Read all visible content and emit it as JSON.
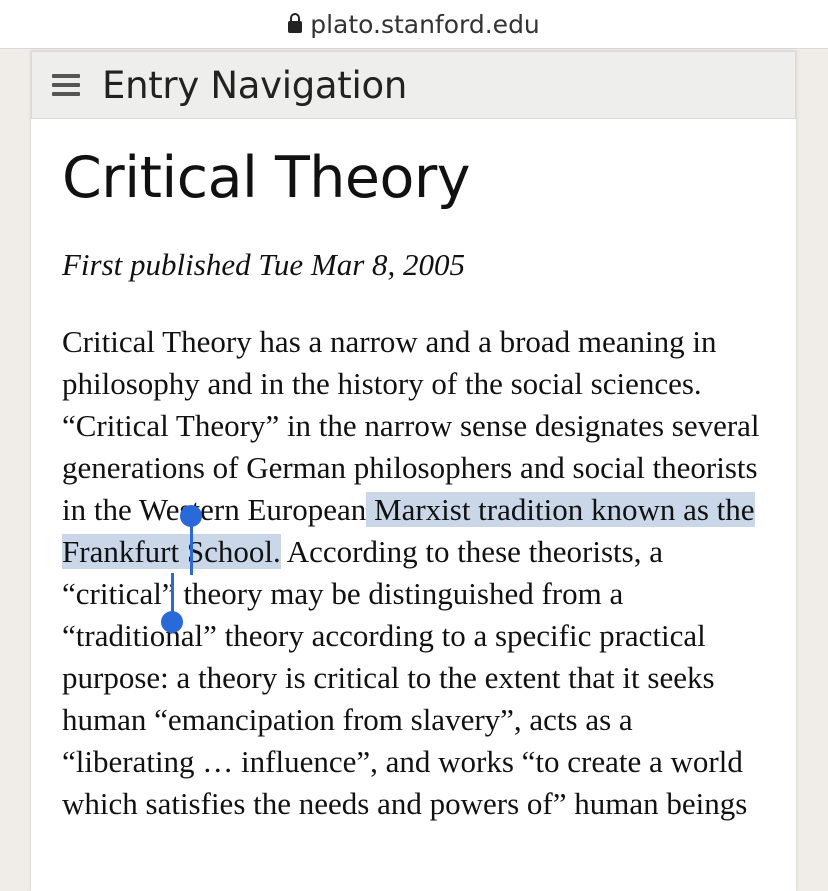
{
  "browser": {
    "url": "plato.stanford.edu"
  },
  "nav": {
    "label": "Entry Navigation"
  },
  "article": {
    "title": "Critical Theory",
    "published": "First published Tue Mar 8, 2005",
    "text_before_selection": "Critical Theory has a narrow and a broad meaning in philosophy and in the history of the social sciences. “Critical Theory” in the narrow sense designates several generations of German philosophers and social theorists in the Western European",
    "selected_text": " Marxist tradition known as the Frankfurt School.",
    "text_after_selection": " According to these theorists, a “critical” theory may be distinguished from a “traditional” theory according to a specific practical purpose: a theory is critical to the extent that it seeks human “emancipation from slavery”, acts as a “liberating … influence”, and works “to create a world which satisfies the needs and powers of” human beings"
  },
  "colors": {
    "selection": "#c9d7e8",
    "handle": "#2a6ad8"
  }
}
